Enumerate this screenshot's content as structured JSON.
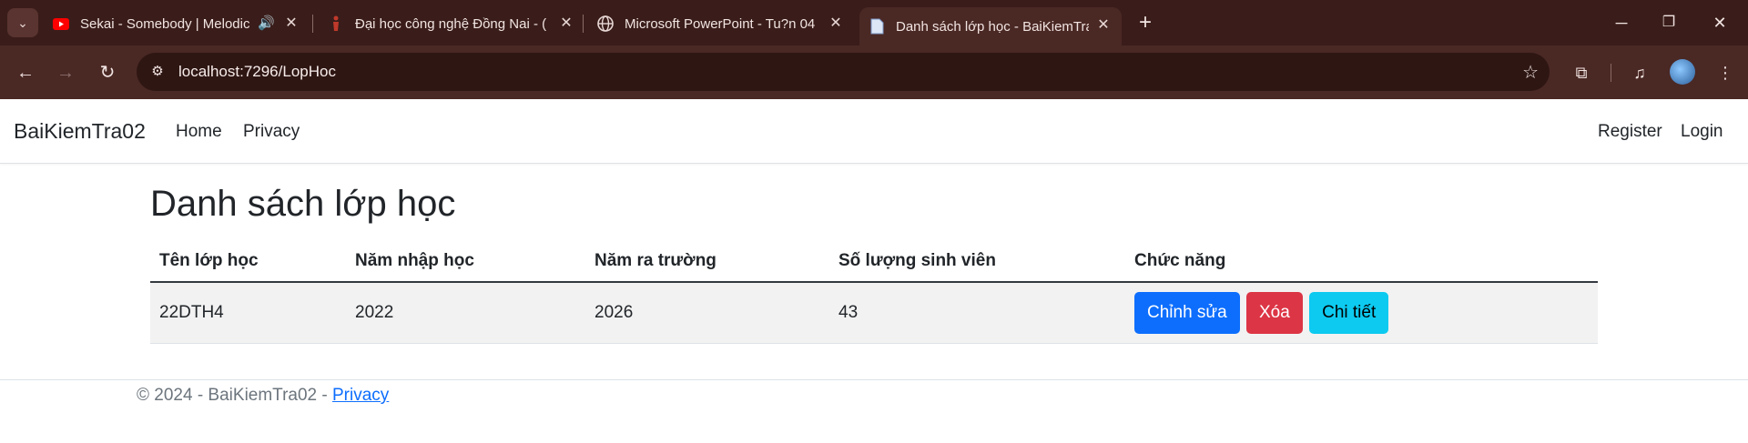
{
  "browser": {
    "tabs": [
      {
        "title": "Sekai - Somebody | Melodic",
        "favicon": "youtube-icon",
        "audio": true
      },
      {
        "title": "Đại học công nghệ Đồng Nai - (",
        "favicon": "dnt-logo-icon"
      },
      {
        "title": "Microsoft PowerPoint - Tu?n 04",
        "favicon": "globe-icon"
      },
      {
        "title": "Danh sách lớp học - BaiKiemTra",
        "favicon": "document-icon",
        "active": true
      }
    ],
    "url": "localhost:7296/LopHoc"
  },
  "navbar": {
    "brand": "BaiKiemTra02",
    "links": [
      "Home",
      "Privacy"
    ],
    "right_links": [
      "Register",
      "Login"
    ]
  },
  "main": {
    "heading": "Danh sách lớp học",
    "table": {
      "headers": [
        "Tên lớp học",
        "Năm nhập học",
        "Năm ra trường",
        "Số lượng sinh viên",
        "Chức năng"
      ],
      "rows": [
        {
          "ten_lop": "22DTH4",
          "nam_nhap_hoc": "2022",
          "nam_ra_truong": "2026",
          "so_luong": "43"
        }
      ],
      "actions": {
        "edit": "Chỉnh sửa",
        "delete": "Xóa",
        "details": "Chi tiết"
      }
    }
  },
  "footer": {
    "text": "© 2024 - BaiKiemTra02 - ",
    "link": "Privacy"
  },
  "colors": {
    "primary": "#0d6efd",
    "danger": "#dc3545",
    "info": "#0dcaf0",
    "chrome_dark": "#3a1d1a"
  }
}
